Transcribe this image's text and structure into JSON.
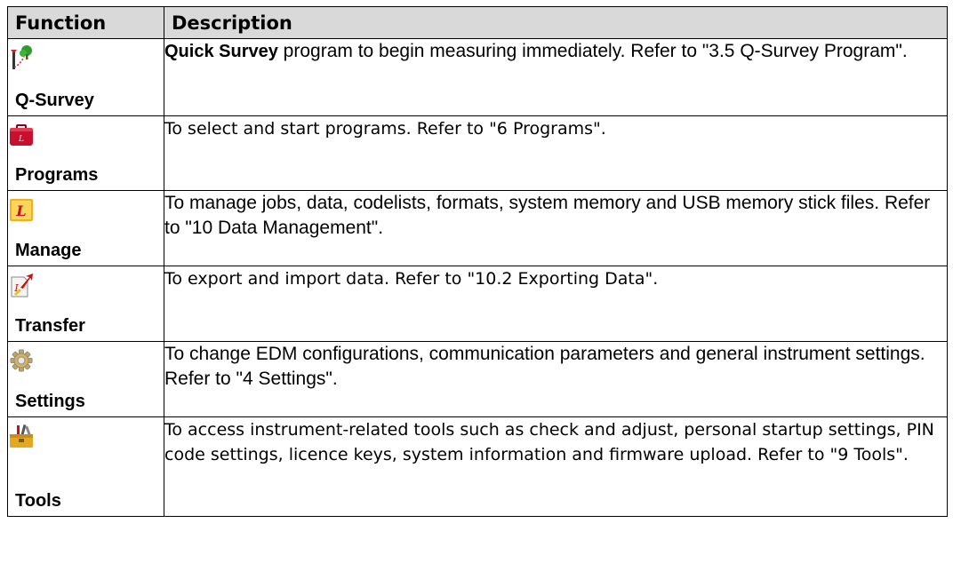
{
  "header": {
    "function": "Function",
    "description": "Description"
  },
  "rows": [
    {
      "icon": "survey-pole-tree-icon",
      "name": "Q-Survey",
      "desc_bold": "Quick Survey",
      "desc": " program to begin measuring immediately. Refer to \"3.5 Q-Survey Program\"."
    },
    {
      "icon": "red-case-icon",
      "name": "Programs",
      "desc": "To select and start programs. Refer to \"6 Programs\"."
    },
    {
      "icon": "folder-icon",
      "name": "Manage",
      "desc": "To manage jobs, data, codelists, formats, system memory and USB memory stick files. Refer to \"10 Data Management\"."
    },
    {
      "icon": "transfer-arrow-icon",
      "name": "Transfer",
      "desc": "To export and import data. Refer to \"10.2 Exporting Data\"."
    },
    {
      "icon": "gear-icon",
      "name": "Settings",
      "desc": "To change EDM configurations, communication parameters and general instrument settings. Refer to \"4 Settings\"."
    },
    {
      "icon": "toolbox-icon",
      "name": "Tools",
      "desc": "To access instrument-related tools such as check and adjust, personal startup settings, PIN code settings, licence keys, system information and firmware upload. Refer to \"9 Tools\"."
    }
  ]
}
